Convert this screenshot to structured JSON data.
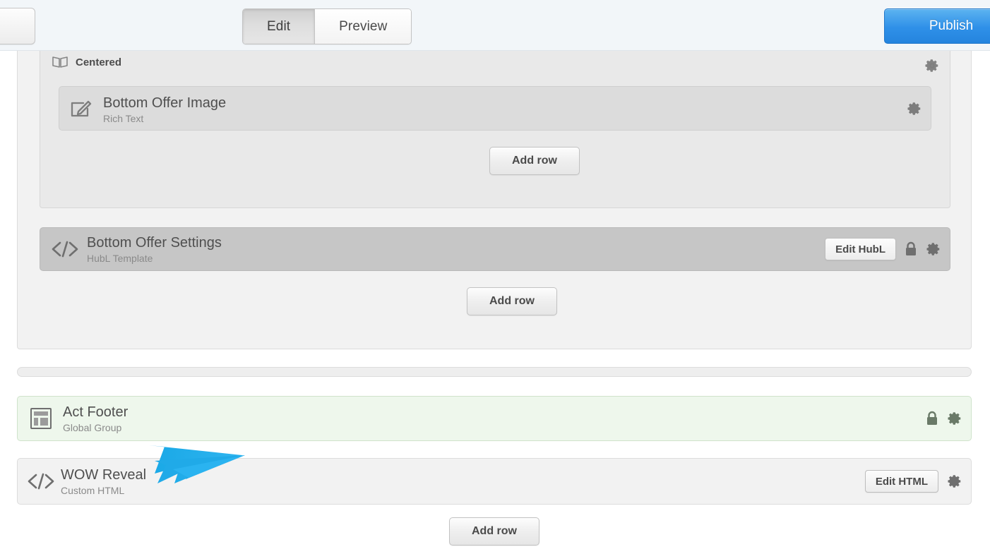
{
  "topbar": {
    "tabs": [
      {
        "label": "Edit",
        "state": "active"
      },
      {
        "label": "Preview",
        "state": "inactive"
      }
    ],
    "publish_label": "Publish",
    "publish_color": "#2f90e8",
    "background": "#f2f6f9"
  },
  "canvas": {
    "group": {
      "header_label": "Centered",
      "header_icon": "book-icon"
    },
    "modules": [
      {
        "title": "Bottom Offer Image",
        "subtitle": "Rich Text",
        "icon": "edit-pencil-icon",
        "actions": [
          "gear-icon"
        ]
      },
      {
        "title": "Bottom Offer Settings",
        "subtitle": "HubL Template",
        "icon": "code-icon",
        "edit_label": "Edit HubL",
        "actions": [
          "edit-hubl-button",
          "lock-icon",
          "gear-icon"
        ]
      },
      {
        "title": "Act Footer",
        "subtitle": "Global Group",
        "icon": "layout-grid-icon",
        "background": "#eef7ec",
        "actions": [
          "lock-icon",
          "gear-icon"
        ]
      },
      {
        "title": "WOW Reveal",
        "subtitle": "Custom HTML",
        "icon": "code-icon",
        "edit_label": "Edit HTML",
        "actions": [
          "edit-html-button",
          "gear-icon"
        ]
      }
    ],
    "add_row_label": "Add row",
    "add_row_count": 3
  },
  "annotation": {
    "type": "arrow",
    "color": "#22a7e8",
    "points_to": "WOW Reveal"
  }
}
